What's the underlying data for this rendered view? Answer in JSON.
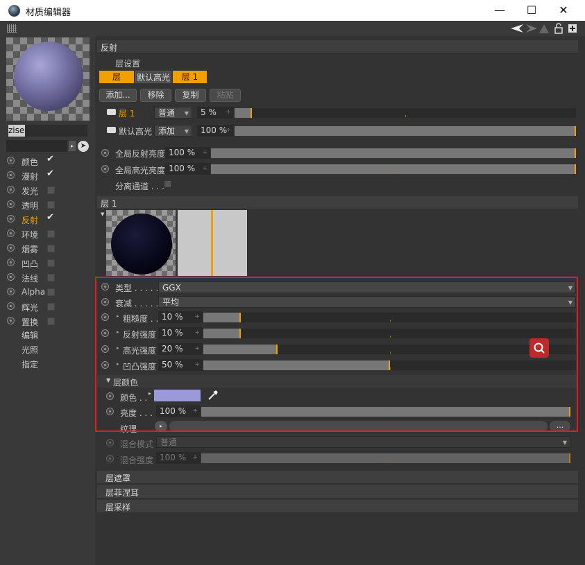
{
  "window": {
    "title": "材质编辑器",
    "min": "—",
    "max": "☐",
    "close": "✕"
  },
  "toolbar": {
    "icons": [
      "arrow-left-icon",
      "arrow-right-icon",
      "mountain-icon",
      "unlock-icon",
      "plus-box-icon"
    ]
  },
  "left": {
    "material_name": "zise",
    "channels": [
      {
        "label": "颜色",
        "checked": true
      },
      {
        "label": "漫射",
        "checked": true
      },
      {
        "label": "发光",
        "checked": false
      },
      {
        "label": "透明",
        "checked": false
      },
      {
        "label": "反射",
        "checked": true,
        "active": true
      },
      {
        "label": "环境",
        "checked": false
      },
      {
        "label": "烟雾",
        "checked": false
      },
      {
        "label": "凹凸",
        "checked": false
      },
      {
        "label": "法线",
        "checked": false
      },
      {
        "label": "Alpha",
        "checked": false
      },
      {
        "label": "辉光",
        "checked": false
      },
      {
        "label": "置换",
        "checked": false
      }
    ],
    "extra": [
      "编辑",
      "光照",
      "指定"
    ]
  },
  "reflect": {
    "header": "反射",
    "layer_settings": "层设置",
    "tabs": [
      "层",
      "默认高光",
      "层 1"
    ],
    "buttons": [
      "添加...",
      "移除",
      "复制",
      "粘贴"
    ],
    "layer1": {
      "name": "层 1",
      "mode": "普通",
      "value": "5 %",
      "fill": 0.05
    },
    "default_spec": {
      "name": "默认高光",
      "mode": "添加",
      "value": "100 %",
      "fill": 1.0
    },
    "global_reflect": {
      "label": "全局反射亮度",
      "value": "100 %",
      "fill": 1.0
    },
    "global_spec": {
      "label": "全局高光亮度",
      "value": "100 %",
      "fill": 1.0
    },
    "separate": "分离通道 . . ."
  },
  "layer1": {
    "header": "层 1",
    "type": {
      "label": "类型 . . . . . .",
      "value": "GGX"
    },
    "attenuation": {
      "label": "衰减 . . . . . . .",
      "value": "平均"
    },
    "roughness": {
      "label": "粗糙度 . .",
      "value": "10 %",
      "fill": 0.1
    },
    "reflect_strength": {
      "label": "反射强度",
      "value": "10 %",
      "fill": 0.1
    },
    "spec_strength": {
      "label": "高光强度",
      "value": "20 %",
      "fill": 0.2
    },
    "bump_strength": {
      "label": "凹凸强度",
      "value": "50 %",
      "fill": 0.5
    },
    "color_section": "层颜色",
    "color": {
      "label": "颜色 . .",
      "swatch": "#9a9ad8"
    },
    "brightness": {
      "label": "亮度 . . . .",
      "value": "100 %",
      "fill": 1.0
    },
    "texture": {
      "label": "纹理 . . .",
      "more": "..."
    },
    "blend_mode": {
      "label": "混合模式",
      "value": "普通"
    },
    "blend_strength": {
      "label": "混合强度",
      "value": "100 %",
      "fill": 1.0
    },
    "mask": "层遮罩",
    "fresnel": "层菲涅耳",
    "sampling": "层采样"
  },
  "colors": {
    "accent": "#f1a000",
    "highlight": "#e02020"
  }
}
